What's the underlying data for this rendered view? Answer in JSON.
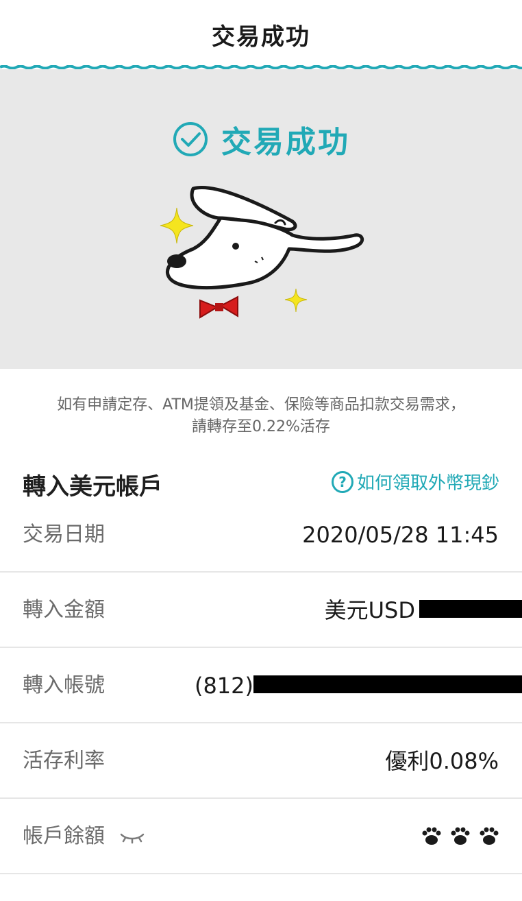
{
  "header": {
    "title": "交易成功"
  },
  "hero": {
    "status_text": "交易成功"
  },
  "notice": {
    "line1": "如有申請定存、ATM提領及基金、保險等商品扣款交易需求，",
    "line2": "請轉存至0.22%活存"
  },
  "section": {
    "title": "轉入美元帳戶",
    "help_link": "如何領取外幣現鈔"
  },
  "rows": [
    {
      "label": "交易日期",
      "value": "2020/05/28 11:45"
    },
    {
      "label": "轉入金額",
      "value": "美元USD"
    },
    {
      "label": "轉入帳號",
      "value": "(812)"
    },
    {
      "label": "活存利率",
      "value": "優利0.08%"
    },
    {
      "label": "帳戶餘額",
      "value": ""
    }
  ],
  "colors": {
    "accent": "#21a9b6",
    "hero_bg": "#e8e8e8",
    "bowtie": "#d61d1d",
    "sparkle": "#f5e51f"
  }
}
